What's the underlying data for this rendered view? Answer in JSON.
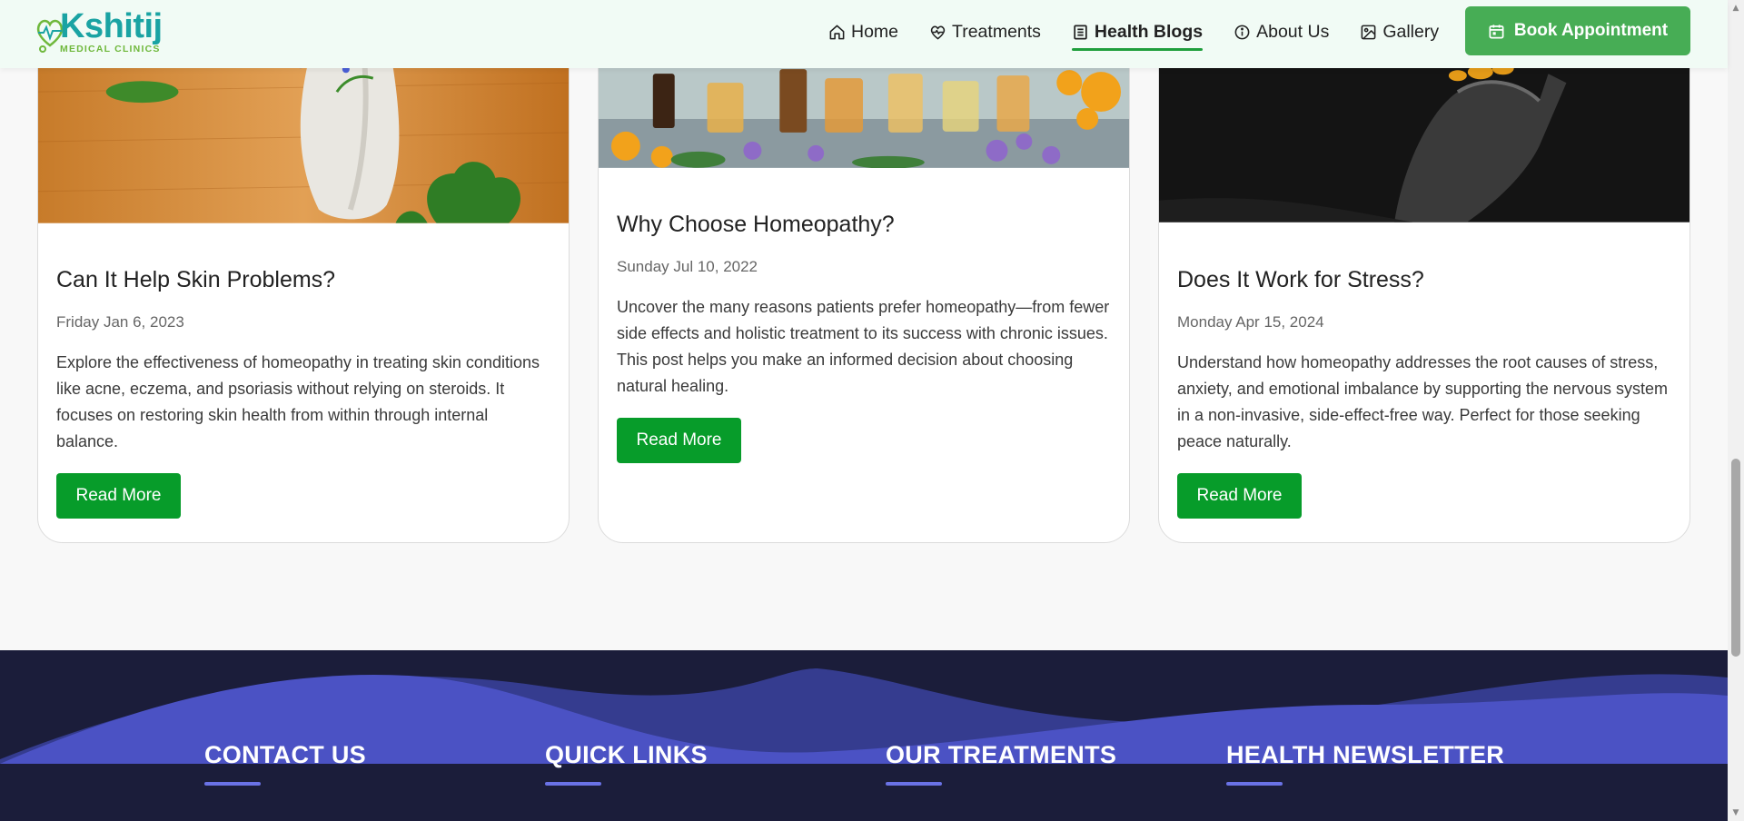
{
  "header": {
    "logo_name": "Kshitij",
    "logo_sub": "MEDICAL CLINICS",
    "nav": [
      {
        "label": "Home",
        "icon": "home-icon"
      },
      {
        "label": "Treatments",
        "icon": "heart-icon"
      },
      {
        "label": "Health Blogs",
        "icon": "newspaper-icon",
        "active": true
      },
      {
        "label": "About Us",
        "icon": "info-icon"
      },
      {
        "label": "Gallery",
        "icon": "image-icon"
      }
    ],
    "book_label": "Book Appointment"
  },
  "cards": [
    {
      "title": "Can It Help Skin Problems?",
      "date": "Friday Jan 6, 2023",
      "description": "Explore the effectiveness of homeopathy in treating skin conditions like acne, eczema, and psoriasis without relying on steroids. It focuses on restoring skin health from within through internal balance.",
      "button": "Read More"
    },
    {
      "title": "Why Choose Homeopathy?",
      "date": "Sunday Jul 10, 2022",
      "description": "Uncover the many reasons patients prefer homeopathy—from fewer side effects and holistic treatment to its success with chronic issues. This post helps you make an informed decision about choosing natural healing.",
      "button": "Read More"
    },
    {
      "title": "Does It Work for Stress?",
      "date": "Monday Apr 15, 2024",
      "description": "Understand how homeopathy addresses the root causes of stress, anxiety, and emotional imbalance by supporting the nervous system in a non-invasive, side-effect-free way. Perfect for those seeking peace naturally.",
      "button": "Read More"
    }
  ],
  "footer": {
    "columns": [
      {
        "heading": "CONTACT US"
      },
      {
        "heading": "QUICK LINKS"
      },
      {
        "heading": "OUR TREATMENTS"
      },
      {
        "heading": "HEALTH NEWSLETTER"
      }
    ]
  },
  "colors": {
    "brand_teal": "#1aa3a3",
    "brand_green": "#6fb83c",
    "button_green": "#079c2a",
    "book_green": "#47ad55",
    "footer_navy": "#1b1d3a",
    "wave_blue": "#4d54c9",
    "accent_underline": "#6a72e6"
  }
}
